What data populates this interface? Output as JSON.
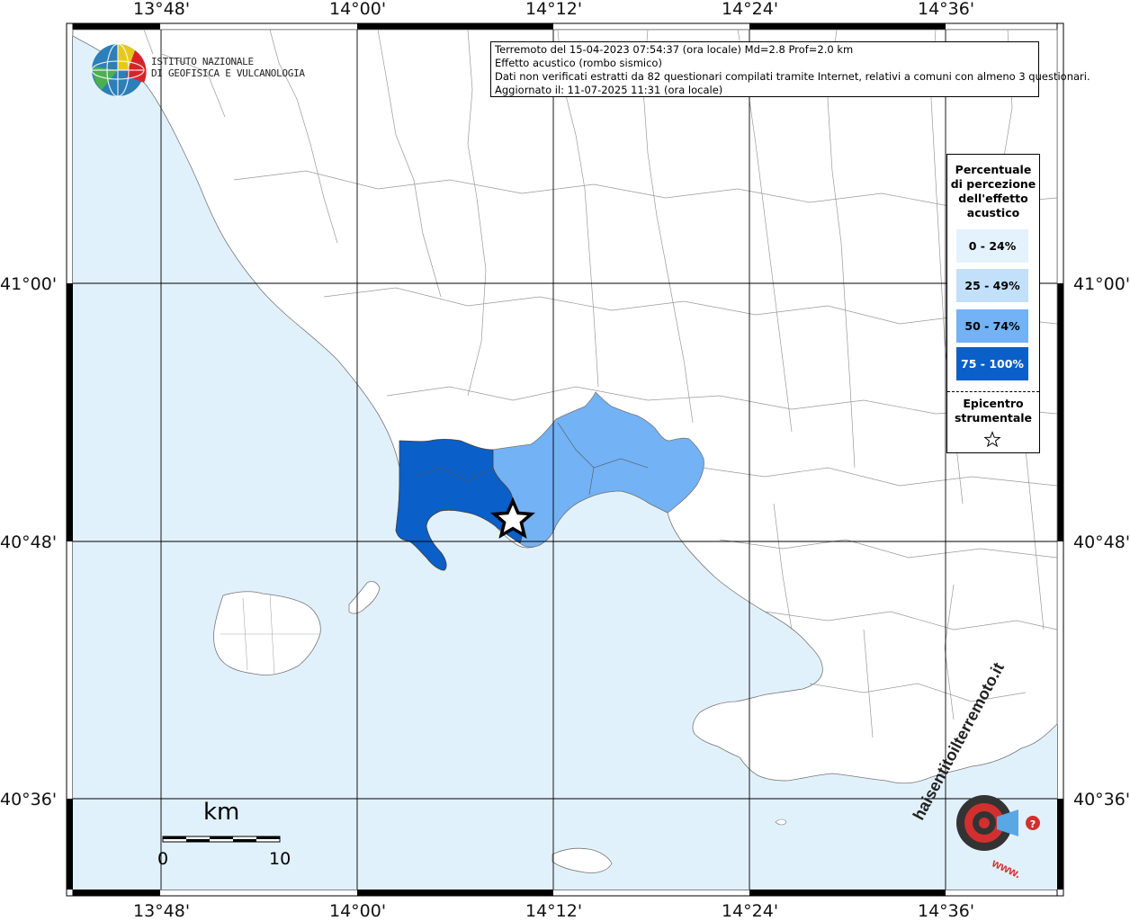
{
  "info": {
    "line1": "Terremoto del 15-04-2023 07:54:37 (ora locale) Md=2.8 Prof=2.0 km",
    "line2": "Effetto acustico (rombo sismico)",
    "line3": "Dati non verificati estratti da 82 questionari compilati tramite Internet, relativi a comuni con almeno 3 questionari.",
    "line4": "Aggiornato il: 11-07-2025 11:31 (ora locale)"
  },
  "axes": {
    "lon_ticks": [
      "13°48'",
      "14°00'",
      "14°12'",
      "14°24'",
      "14°36'"
    ],
    "lat_ticks": [
      "41°00'",
      "40°48'",
      "40°36'"
    ]
  },
  "legend": {
    "title": "Percentuale di percezione dell'effetto acustico",
    "title_lines": [
      "Percentuale",
      "di percezione",
      "dell'effetto",
      "acustico"
    ],
    "classes": [
      {
        "label": "0 - 24%",
        "color": "#e3f2fc",
        "text_color": "#000000"
      },
      {
        "label": "25 - 49%",
        "color": "#c2e0fa",
        "text_color": "#000000"
      },
      {
        "label": "50 - 74%",
        "color": "#72b2f5",
        "text_color": "#000000"
      },
      {
        "label": "75 - 100%",
        "color": "#0a5fc8",
        "text_color": "#ffffff"
      }
    ],
    "epicenter_lines": [
      "Epicentro",
      "strumentale"
    ],
    "epicenter_icon": "star-icon"
  },
  "logo": {
    "line1": "ISTITUTO NAZIONALE",
    "line2": "DI GEOFISICA E VULCANOLOGIA"
  },
  "scale": {
    "unit": "km",
    "start": "0",
    "end": "10"
  },
  "badge": {
    "text": "haisentitoilterremoto.it",
    "www": "www."
  },
  "colors": {
    "sea": "#e1f1fc",
    "land": "#ffffff",
    "class_75_100": "#0a5fc8",
    "class_50_74": "#72b2f5"
  }
}
